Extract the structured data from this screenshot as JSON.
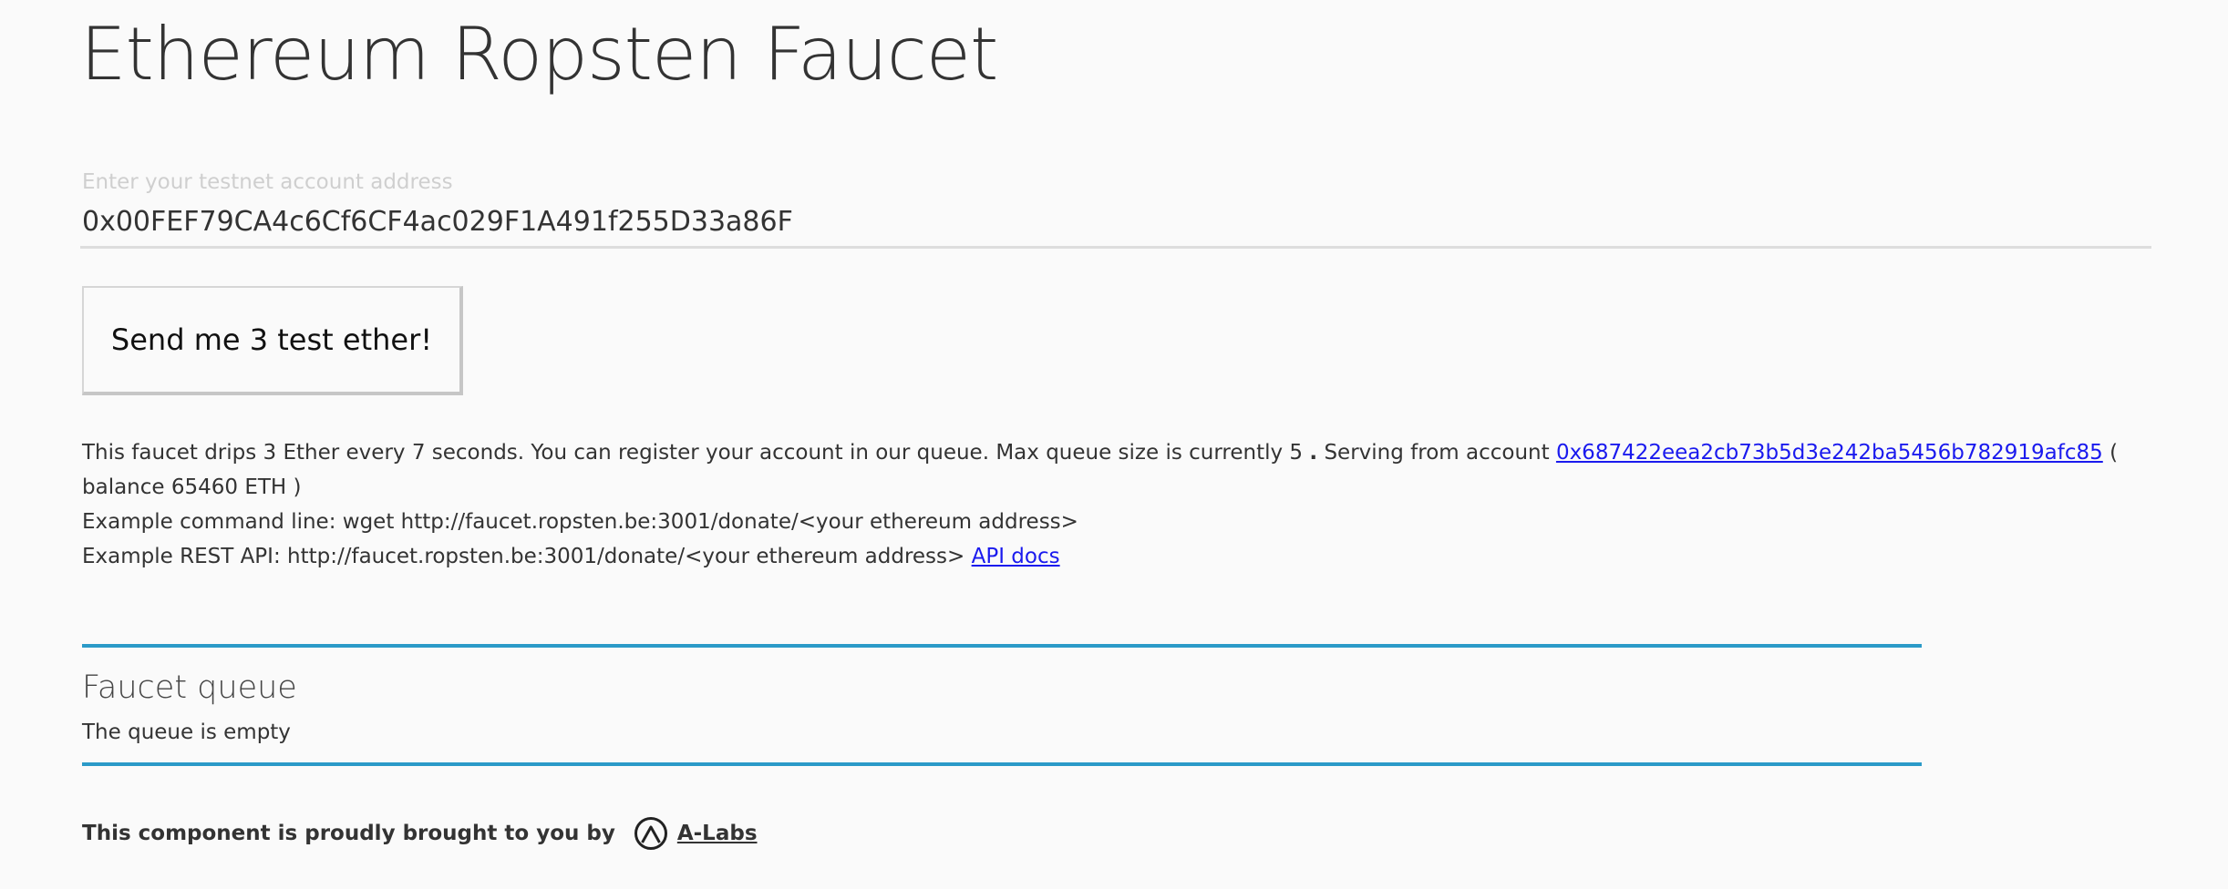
{
  "page": {
    "title": "Ethereum Ropsten Faucet"
  },
  "form": {
    "label": "Enter your testnet account address",
    "address_value": "0x00FEF79CA4c6Cf6CF4ac029F1A491f255D33a86F",
    "send_button_label": "Send me 3 test ether!"
  },
  "info": {
    "line1_text_a": "This faucet drips 3 Ether every 7 seconds. You can register your account in our queue. Max queue size is currently 5",
    "line1_dot": ".",
    "line1_text_b": "Serving from account",
    "account_link": "0x687422eea2cb73b5d3e242ba5456b782919afc85",
    "line1_text_c": "( balance 65460 ETH )",
    "line2": "Example command line: wget http://faucet.ropsten.be:3001/donate/<your ethereum address>",
    "line3_text": "Example REST API: http://faucet.ropsten.be:3001/donate/<your ethereum address>",
    "api_docs_link": "API docs"
  },
  "queue": {
    "title": "Faucet queue",
    "status": "The queue is empty"
  },
  "footer": {
    "text": "This component is proudly brought to you by",
    "logo_icon": "a-labs-logo-icon",
    "brand_link": "A-Labs"
  },
  "colors": {
    "background": "#fafafa",
    "accent": "#2b9ac8",
    "link": "#1a1aee"
  }
}
